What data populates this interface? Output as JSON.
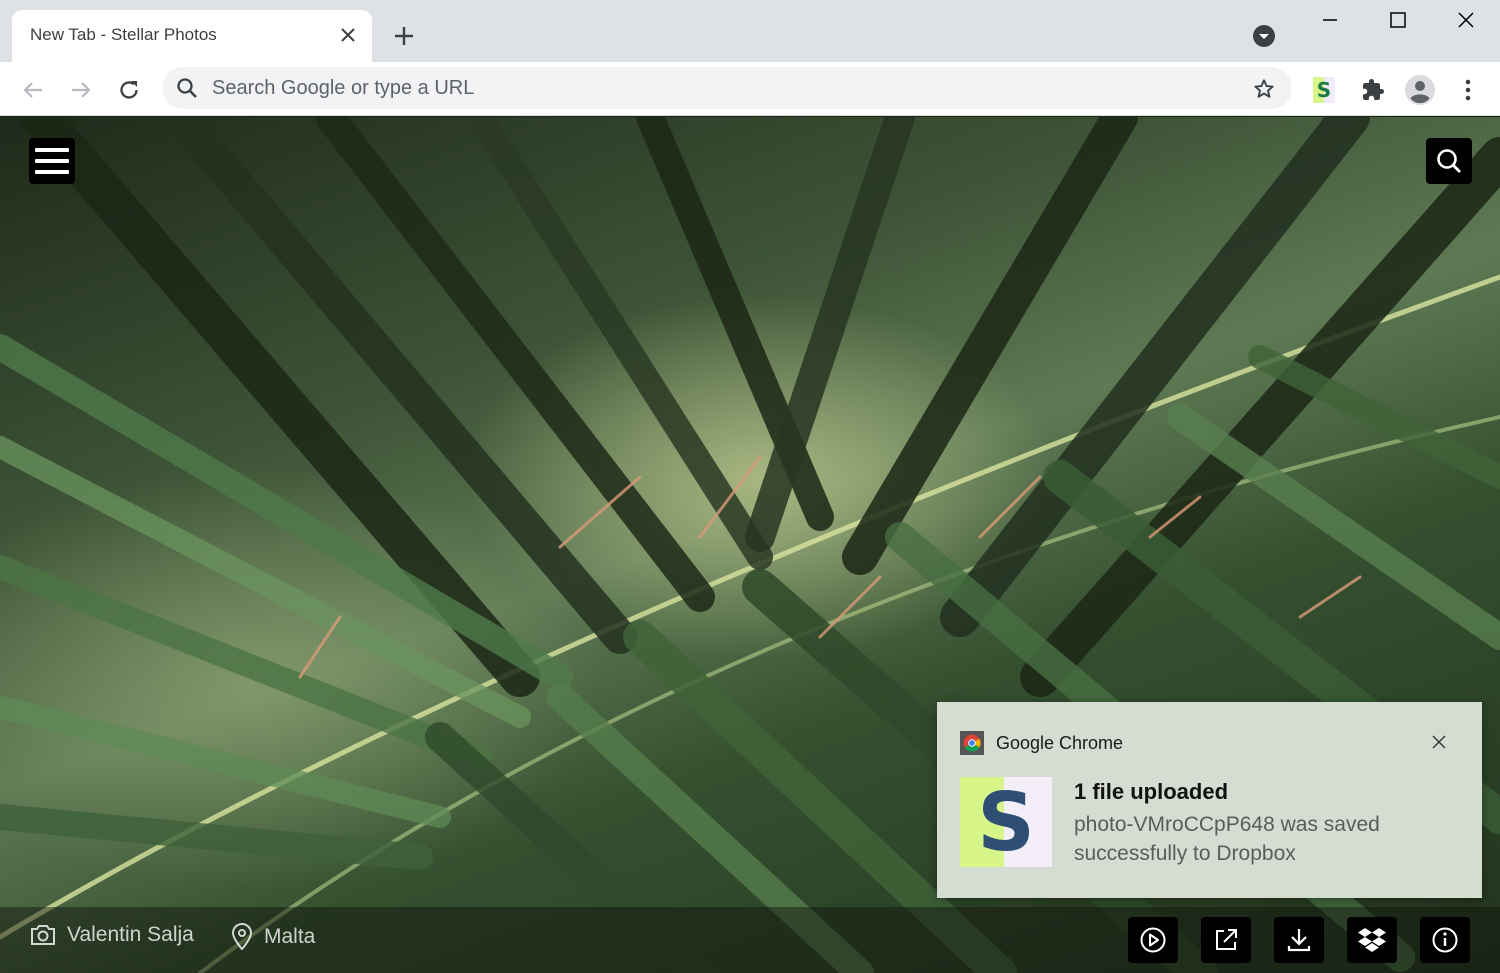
{
  "browser": {
    "tab": {
      "title": "New Tab - Stellar Photos"
    },
    "omnibox": {
      "placeholder": "Search Google or type a URL"
    },
    "extension_badge_letter": "S"
  },
  "page": {
    "credits": {
      "photographer": "Valentin Salja",
      "location": "Malta"
    },
    "actions": [
      "play-icon",
      "open-external-icon",
      "download-icon",
      "dropbox-icon",
      "info-icon"
    ]
  },
  "notification": {
    "app_name": "Google Chrome",
    "thumbnail_letter": "S",
    "title": "1 file uploaded",
    "message": "photo-VMroCCpP648 was saved successfully to Dropbox"
  },
  "colors": {
    "tabstrip": "#dee1e6",
    "toolbar": "#ffffff",
    "omnibox": "#f1f3f4",
    "notification_bg": "#d5dcd2",
    "accent_green": "#d8f58a"
  }
}
